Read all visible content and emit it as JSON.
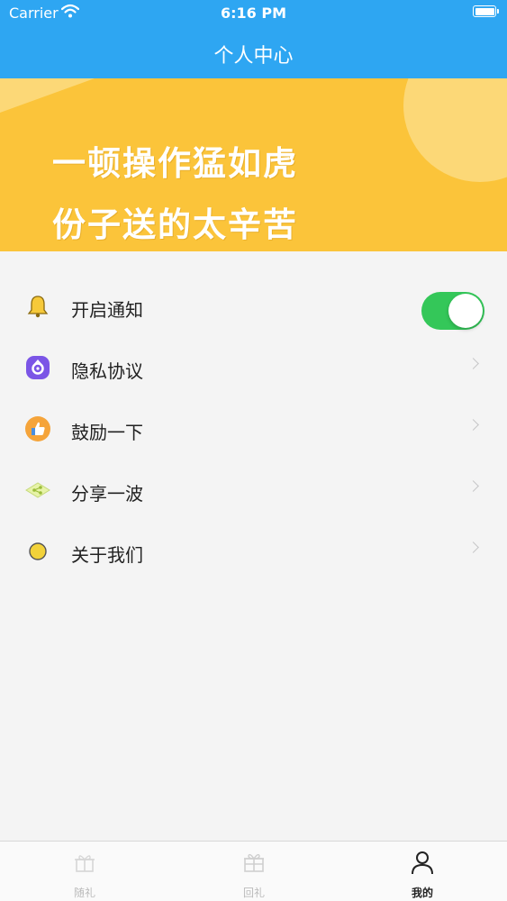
{
  "status_bar": {
    "carrier": "Carrier",
    "time": "6:16 PM"
  },
  "nav": {
    "title": "个人中心"
  },
  "banner": {
    "line1": "一顿操作猛如虎",
    "line2": "份子送的太辛苦"
  },
  "menu": [
    {
      "label": "开启通知",
      "icon": "bell-icon",
      "toggle": true,
      "toggle_on": true
    },
    {
      "label": "隐私协议",
      "icon": "privacy-lock-icon"
    },
    {
      "label": "鼓励一下",
      "icon": "thumbs-up-icon"
    },
    {
      "label": "分享一波",
      "icon": "share-icon"
    },
    {
      "label": "关于我们",
      "icon": "info-circle-icon"
    }
  ],
  "tabs": [
    {
      "label": "随礼",
      "icon": "gift-box-icon",
      "active": false
    },
    {
      "label": "回礼",
      "icon": "gift-icon",
      "active": false
    },
    {
      "label": "我的",
      "icon": "person-icon",
      "active": true
    }
  ],
  "colors": {
    "nav": "#2ea6f2",
    "banner": "#fbc43a",
    "toggle_on": "#34c759"
  }
}
